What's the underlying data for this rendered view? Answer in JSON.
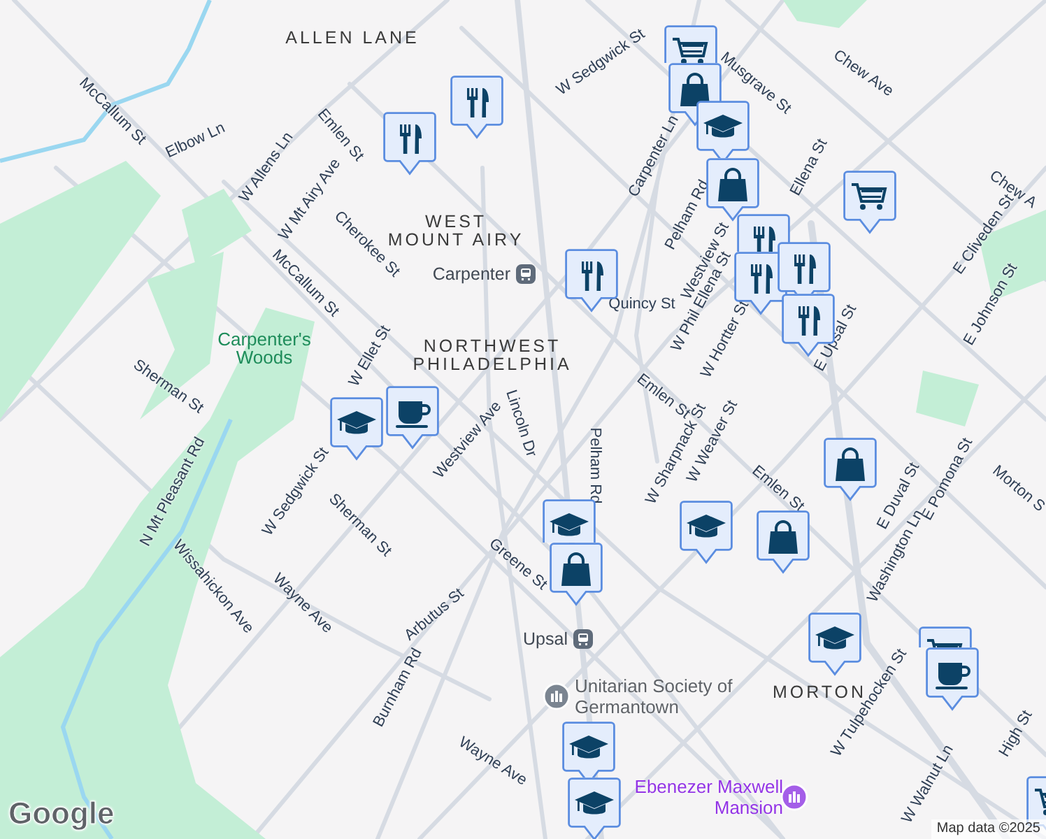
{
  "map": {
    "area_labels": [
      "ALLEN LANE",
      "WEST MOUNT AIRY",
      "NORTHWEST PHILADELPHIA",
      "MORTON"
    ],
    "park_labels": [
      "Carpenter's Woods"
    ],
    "street_labels": [
      "McCallum St",
      "Elbow Ln",
      "W Allens Ln",
      "Emlen St",
      "W Mt Airy Ave",
      "Cherokee St",
      "McCallum St",
      "W Ellet St",
      "Sherman St",
      "N Mt Pleasant Rd",
      "W Sedgwick St",
      "Sherman St",
      "Westview Ave",
      "Lincoln Dr",
      "Wissahickon Ave",
      "Wayne Ave",
      "Arbutus St",
      "Burnham Rd",
      "Greene St",
      "Wayne Ave",
      "Pelham Rd",
      "W Sedgwick St",
      "Musgrave St",
      "Carpenter Ln",
      "Pelham Rd",
      "Westview St",
      "W Phil Ellena St",
      "Quincy St",
      "W Hortter St",
      "Chew Ave",
      "Chew A",
      "E Upsal St",
      "E Cliveden St",
      "E Johnson St",
      "Emlen St",
      "W Sharpnack St",
      "W Weaver St",
      "Emlen St",
      "E Duval St",
      "E Pomona St",
      "Washington Ln",
      "W Tulpehocken St",
      "W Walnut Ln",
      "High St",
      "Morton S",
      "Ellena St"
    ],
    "transit_stations": [
      "Carpenter",
      "Upsal"
    ],
    "places": [
      {
        "kind": "worship",
        "name": "Unitarian Society of Germantown"
      },
      {
        "kind": "museum",
        "name": "Ebenezer Maxwell Mansion"
      }
    ],
    "markers": [
      {
        "kind": "restaurant"
      },
      {
        "kind": "restaurant"
      },
      {
        "kind": "cart"
      },
      {
        "kind": "bag"
      },
      {
        "kind": "school"
      },
      {
        "kind": "bag"
      },
      {
        "kind": "restaurant"
      },
      {
        "kind": "restaurant"
      },
      {
        "kind": "restaurant"
      },
      {
        "kind": "restaurant"
      },
      {
        "kind": "cart"
      },
      {
        "kind": "restaurant"
      },
      {
        "kind": "coffee"
      },
      {
        "kind": "school"
      },
      {
        "kind": "school"
      },
      {
        "kind": "bag"
      },
      {
        "kind": "school"
      },
      {
        "kind": "bag"
      },
      {
        "kind": "bag"
      },
      {
        "kind": "school"
      },
      {
        "kind": "cart"
      },
      {
        "kind": "coffee"
      },
      {
        "kind": "school"
      },
      {
        "kind": "school"
      },
      {
        "kind": "cart"
      }
    ],
    "logo": "Google",
    "attribution": "Map data ©2025"
  }
}
